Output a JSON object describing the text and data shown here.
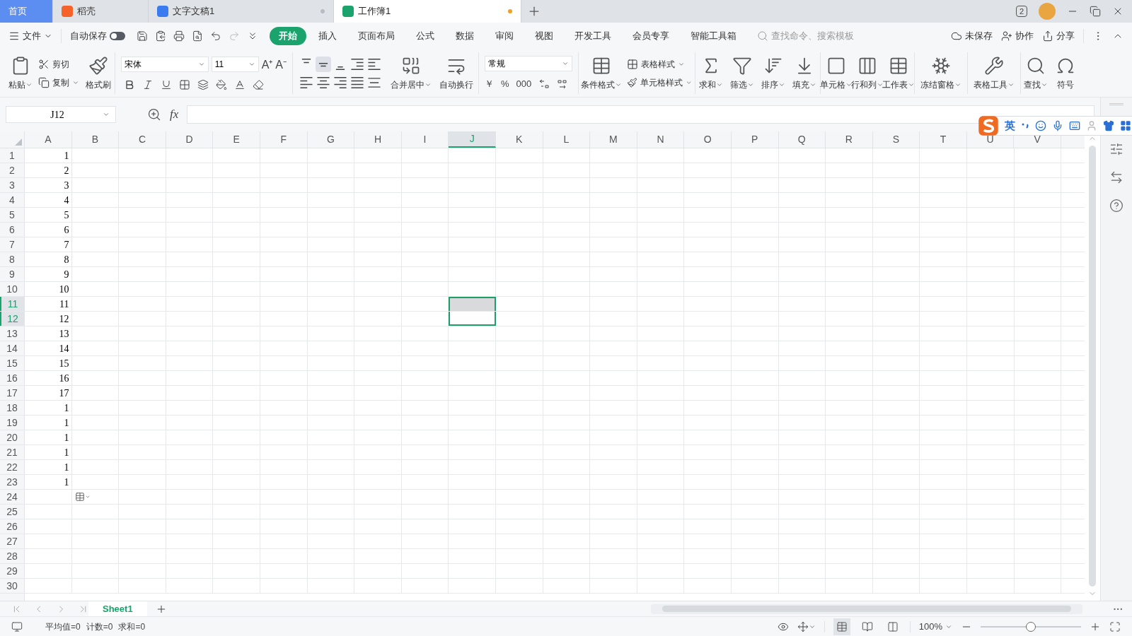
{
  "title_bar": {
    "tabs": [
      {
        "label": "首页",
        "kind": "home"
      },
      {
        "label": "稻壳",
        "kind": "docer",
        "selected": false
      },
      {
        "label": "文字文稿1",
        "kind": "writer",
        "selected": false,
        "modified": false
      },
      {
        "label": "工作簿1",
        "kind": "sheet",
        "selected": true,
        "modified": true
      }
    ],
    "window_count": "2"
  },
  "menu_bar": {
    "file": "文件",
    "autosave": {
      "label": "自动保存",
      "on": false
    },
    "tabs": [
      {
        "label": "开始",
        "selected": true
      },
      {
        "label": "插入",
        "selected": false
      },
      {
        "label": "页面布局",
        "selected": false
      },
      {
        "label": "公式",
        "selected": false
      },
      {
        "label": "数据",
        "selected": false
      },
      {
        "label": "审阅",
        "selected": false
      },
      {
        "label": "视图",
        "selected": false
      },
      {
        "label": "开发工具",
        "selected": false
      },
      {
        "label": "会员专享",
        "selected": false
      },
      {
        "label": "智能工具箱",
        "selected": false
      }
    ],
    "search_placeholder": "查找命令、搜索模板",
    "actions": [
      "未保存",
      "协作",
      "分享"
    ]
  },
  "ribbon": {
    "paste": "粘贴",
    "cut": "剪切",
    "copy": "复制",
    "format_painter": "格式刷",
    "font": "宋体",
    "font_size": "11",
    "font_size_buttons": [
      "A⁺",
      "A⁻"
    ],
    "vertical_align": [
      {
        "selected": false
      },
      {
        "selected": true
      },
      {
        "selected": false
      }
    ],
    "merge": "合并居中",
    "wrap": "自动换行",
    "number_format": "常规",
    "number_buttons": [
      "￥",
      "%",
      "000"
    ],
    "conditional_format": "条件格式",
    "table_style": "表格样式",
    "cell_style": "单元格样式",
    "tools": [
      "求和",
      "筛选",
      "排序",
      "填充",
      "单元格",
      "行和列",
      "工作表",
      "冻结窗格",
      "表格工具",
      "查找",
      "符号"
    ]
  },
  "formula_bar": {
    "name_box": "J12",
    "fx": "fx"
  },
  "sheet": {
    "columns": [
      {
        "label": "A",
        "selected": false
      },
      {
        "label": "B",
        "selected": false
      },
      {
        "label": "C",
        "selected": false
      },
      {
        "label": "D",
        "selected": false
      },
      {
        "label": "E",
        "selected": false
      },
      {
        "label": "F",
        "selected": false
      },
      {
        "label": "G",
        "selected": false
      },
      {
        "label": "H",
        "selected": false
      },
      {
        "label": "I",
        "selected": false
      },
      {
        "label": "J",
        "selected": true
      },
      {
        "label": "K",
        "selected": false
      },
      {
        "label": "L",
        "selected": false
      },
      {
        "label": "M",
        "selected": false
      },
      {
        "label": "N",
        "selected": false
      },
      {
        "label": "O",
        "selected": false
      },
      {
        "label": "P",
        "selected": false
      },
      {
        "label": "Q",
        "selected": false
      },
      {
        "label": "R",
        "selected": false
      },
      {
        "label": "S",
        "selected": false
      },
      {
        "label": "T",
        "selected": false
      },
      {
        "label": "U",
        "selected": false
      },
      {
        "label": "V",
        "selected": false
      }
    ],
    "rows": [
      {
        "label": "1",
        "a": "1",
        "selected": false
      },
      {
        "label": "2",
        "a": "2",
        "selected": false
      },
      {
        "label": "3",
        "a": "3",
        "selected": false
      },
      {
        "label": "4",
        "a": "4",
        "selected": false
      },
      {
        "label": "5",
        "a": "5",
        "selected": false
      },
      {
        "label": "6",
        "a": "6",
        "selected": false
      },
      {
        "label": "7",
        "a": "7",
        "selected": false
      },
      {
        "label": "8",
        "a": "8",
        "selected": false
      },
      {
        "label": "9",
        "a": "9",
        "selected": false
      },
      {
        "label": "10",
        "a": "10",
        "selected": false
      },
      {
        "label": "11",
        "a": "11",
        "selected": true,
        "active": false
      },
      {
        "label": "12",
        "a": "12",
        "selected": true,
        "active": true
      },
      {
        "label": "13",
        "a": "13",
        "selected": false
      },
      {
        "label": "14",
        "a": "14",
        "selected": false
      },
      {
        "label": "15",
        "a": "15",
        "selected": false
      },
      {
        "label": "16",
        "a": "16",
        "selected": false
      },
      {
        "label": "17",
        "a": "17",
        "selected": false
      },
      {
        "label": "18",
        "a": "1",
        "selected": false
      },
      {
        "label": "19",
        "a": "1",
        "selected": false
      },
      {
        "label": "20",
        "a": "1",
        "selected": false
      },
      {
        "label": "21",
        "a": "1",
        "selected": false
      },
      {
        "label": "22",
        "a": "1",
        "selected": false
      },
      {
        "label": "23",
        "a": "1",
        "selected": false
      },
      {
        "label": "24",
        "selected": false
      },
      {
        "label": "25",
        "selected": false
      },
      {
        "label": "26",
        "selected": false
      },
      {
        "label": "27",
        "selected": false
      },
      {
        "label": "28",
        "selected": false
      },
      {
        "label": "29",
        "selected": false
      },
      {
        "label": "30",
        "selected": false
      }
    ]
  },
  "sheet_tabs": [
    {
      "label": "Sheet1",
      "selected": true
    }
  ],
  "status_bar": {
    "stats": [
      "平均值=0",
      "计数=0",
      "求和=0"
    ],
    "views": [
      {
        "selected": true
      },
      {
        "selected": false
      },
      {
        "selected": false
      }
    ],
    "zoom": "100%",
    "zoom_slider": {
      "level": 0.5
    }
  },
  "ime_bar": {
    "mode": "英"
  }
}
